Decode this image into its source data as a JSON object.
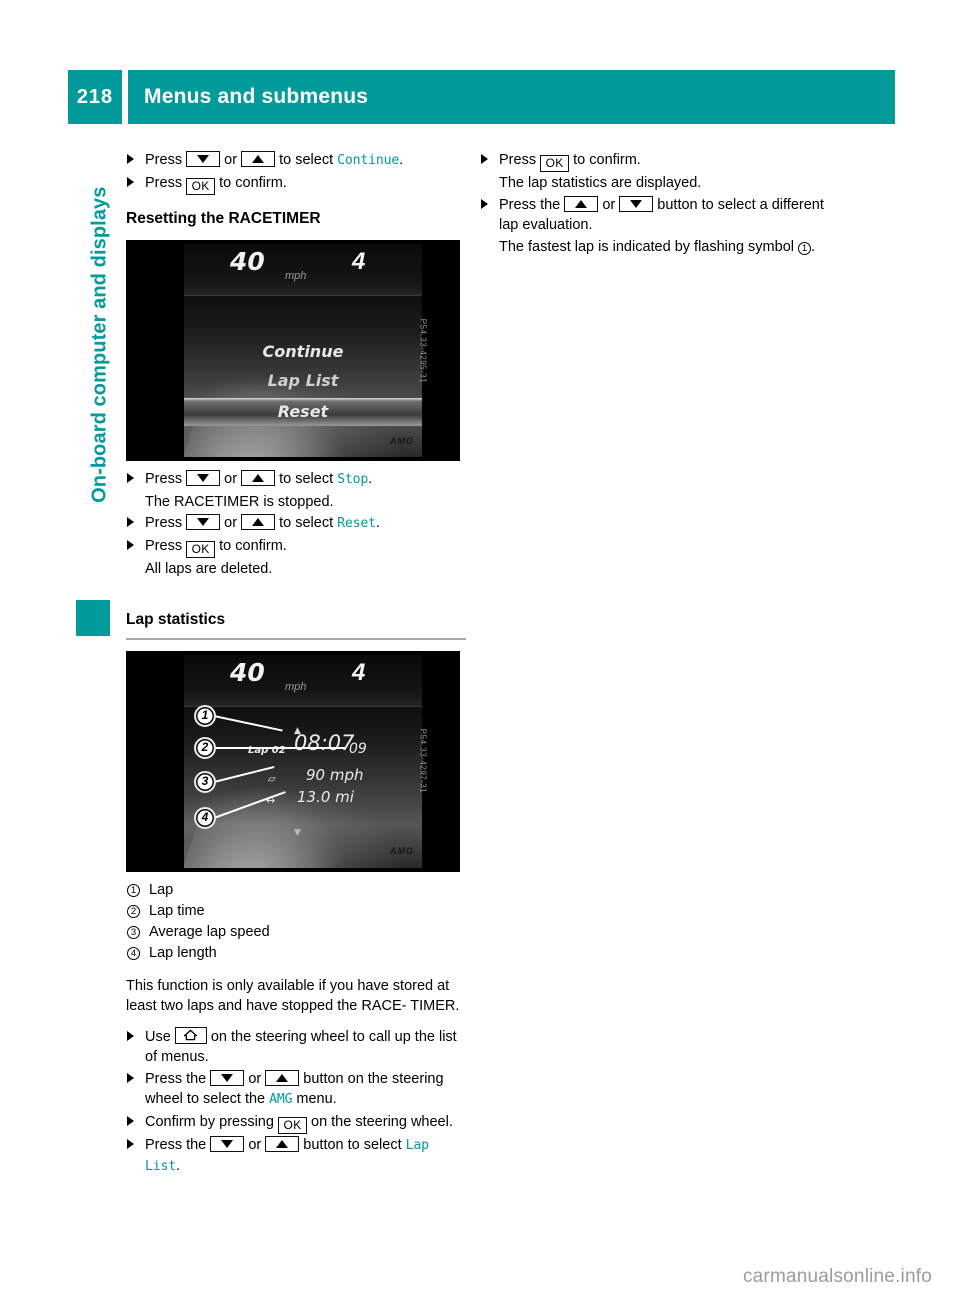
{
  "header": {
    "page_number": "218",
    "title": "Menus and submenus",
    "accent_color": "#029a9a"
  },
  "sidebar": {
    "chapter_label": "On-board computer and displays"
  },
  "keys": {
    "down": "down-arrow-button",
    "up": "up-arrow-button",
    "ok": "OK",
    "home": "home-button"
  },
  "left_column": {
    "step1": {
      "pre": "Press",
      "mid": "or",
      "post": "to select",
      "term": "Continue",
      "end": "."
    },
    "step2": {
      "pre": "Press",
      "post": "to confirm."
    },
    "heading_resetting": "Resetting the RACETIMER",
    "screenshot1": {
      "speed": "40",
      "unit": "mph",
      "gear": "4",
      "menu_items": [
        "Continue",
        "Lap List",
        "Reset"
      ],
      "selected_item": "Reset",
      "brand": "AMG",
      "code": "P54.33-4295-31"
    },
    "step3": {
      "pre": "Press",
      "mid": "or",
      "post": "to select",
      "term": "Stop",
      "end": "."
    },
    "step3_note": "The RACETIMER is stopped.",
    "step4": {
      "pre": "Press",
      "mid": "or",
      "post": "to select",
      "term": "Reset",
      "end": "."
    },
    "step5": {
      "pre": "Press",
      "post": "to confirm."
    },
    "step5_note": "All laps are deleted.",
    "heading_lap_statistics": "Lap statistics",
    "screenshot2": {
      "speed": "40",
      "unit": "mph",
      "gear": "4",
      "lap_label": "Lap 02",
      "lap_time": "08:07",
      "lap_time_decimals": "09",
      "avg_speed": "90 mph",
      "lap_length": "13.0 mi",
      "brand": "AMG",
      "code": "P54.33-4297-31",
      "callouts": [
        "1",
        "2",
        "3",
        "4"
      ]
    },
    "legend": [
      {
        "num": "1",
        "label": "Lap"
      },
      {
        "num": "2",
        "label": "Lap time"
      },
      {
        "num": "3",
        "label": "Average lap speed"
      },
      {
        "num": "4",
        "label": "Lap length"
      }
    ],
    "availability_note": "This function is only available if you have stored at least two laps and have stopped the RACE- TIMER.",
    "step6": {
      "pre": "Use",
      "post": "on the steering wheel to call up the list of menus."
    },
    "step7": {
      "pre": "Press the",
      "mid": "or",
      "post": "button on the steering wheel to select the",
      "term": "AMG",
      "end": "menu."
    },
    "step8": {
      "pre": "Confirm by pressing",
      "post": "on the steering wheel."
    },
    "step9": {
      "pre": "Press the",
      "mid": "or",
      "post": "button to select",
      "term": "Lap List",
      "end": "."
    }
  },
  "right_column": {
    "step1": {
      "pre": "Press",
      "post": "to confirm."
    },
    "step1_note": "The lap statistics are displayed.",
    "step2": {
      "pre": "Press the",
      "mid": "or",
      "post": "button to select a different lap evaluation."
    },
    "step2_note_a": "The fastest lap is indicated by flashing symbol",
    "step2_note_b": ".",
    "step2_symbol": "1"
  },
  "footer": {
    "watermark": "carmanualsonline.info"
  }
}
